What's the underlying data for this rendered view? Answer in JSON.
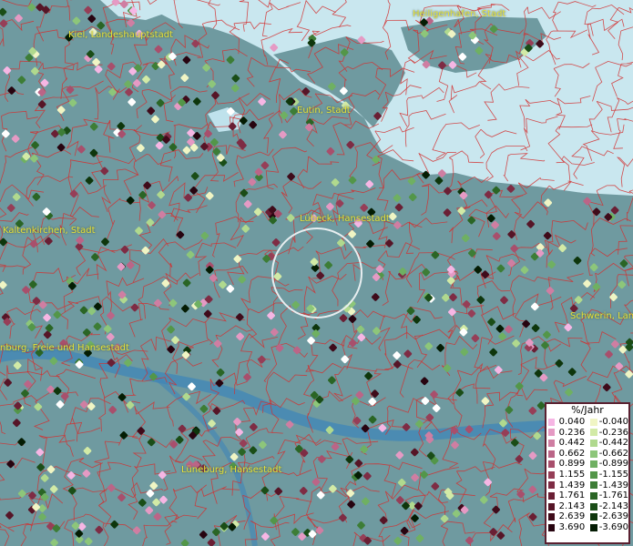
{
  "places": [
    {
      "id": "kiel",
      "label": "Kiel, Landeshauptstadt"
    },
    {
      "id": "heiligenhafen",
      "label": "Heiligenhafen, Stadt"
    },
    {
      "id": "eutin",
      "label": "Eutin, Stadt"
    },
    {
      "id": "luebeck",
      "label": "Lübeck, Hansestadt"
    },
    {
      "id": "kaltenkirchen",
      "label": "Kaltenkirchen, Stadt"
    },
    {
      "id": "schwerin",
      "label": "Schwerin, Lan"
    },
    {
      "id": "hamburg",
      "label": "nburg, Freie und Hansestadt"
    },
    {
      "id": "lueneburg",
      "label": "Lüneburg, Hansestadt"
    }
  ],
  "legend": {
    "title": "%/Jahr",
    "positive": [
      {
        "label": "0.040",
        "color": "#f6b6e4"
      },
      {
        "label": "0.236",
        "color": "#e59ac4"
      },
      {
        "label": "0.442",
        "color": "#cf7ea2"
      },
      {
        "label": "0.662",
        "color": "#bb6587"
      },
      {
        "label": "0.899",
        "color": "#a84f6c"
      },
      {
        "label": "1.155",
        "color": "#963e57"
      },
      {
        "label": "1.439",
        "color": "#7e2c44"
      },
      {
        "label": "1.761",
        "color": "#6a1f34"
      },
      {
        "label": "2.143",
        "color": "#561527"
      },
      {
        "label": "2.639",
        "color": "#3f0b1a"
      },
      {
        "label": "3.690",
        "color": "#270410"
      }
    ],
    "negative": [
      {
        "label": "-0.040",
        "color": "#f0f5c4"
      },
      {
        "label": "-0.236",
        "color": "#d2eaa6"
      },
      {
        "label": "-0.442",
        "color": "#b0d98e"
      },
      {
        "label": "-0.662",
        "color": "#8dc67a"
      },
      {
        "label": "-0.899",
        "color": "#6fb062"
      },
      {
        "label": "-1.155",
        "color": "#539649"
      },
      {
        "label": "-1.439",
        "color": "#3d7d36"
      },
      {
        "label": "-1.761",
        "color": "#2a6525"
      },
      {
        "label": "-2.143",
        "color": "#1a4d17"
      },
      {
        "label": "-2.639",
        "color": "#0e360c"
      },
      {
        "label": "-3.690",
        "color": "#041c03"
      }
    ]
  },
  "colors": {
    "land": "#6f9aa0",
    "sea": "#c8e6ee",
    "river": "#4b8fb8",
    "borders": "#d23030",
    "label": "#e6e23a",
    "zero": "#ffffff"
  }
}
